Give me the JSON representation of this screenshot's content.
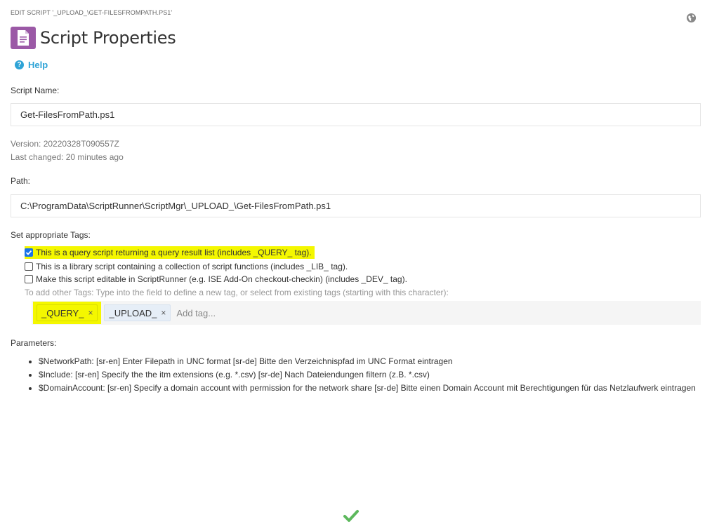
{
  "header": {
    "breadcrumb": "EDIT SCRIPT '_UPLOAD_\\GET-FILESFROMPATH.PS1'",
    "title": "Script Properties",
    "help_label": "Help",
    "help_glyph": "?"
  },
  "script_name": {
    "label": "Script Name:",
    "value": "Get-FilesFromPath.ps1"
  },
  "meta": {
    "version": "Version: 20220328T090557Z",
    "last_changed": "Last changed: 20 minutes ago"
  },
  "path": {
    "label": "Path:",
    "value": "C:\\ProgramData\\ScriptRunner\\ScriptMgr\\_UPLOAD_\\Get-FilesFromPath.ps1"
  },
  "tags": {
    "label": "Set appropriate Tags:",
    "options": [
      {
        "label": "This is a query script returning a query result list (includes _QUERY_ tag).",
        "checked": true
      },
      {
        "label": "This is a library script containing a collection of script functions (includes _LIB_ tag).",
        "checked": false
      },
      {
        "label": "Make this script editable in ScriptRunner (e.g. ISE Add-On checkout-checkin) (includes _DEV_ tag).",
        "checked": false
      }
    ],
    "hint": "To add other Tags: Type into the field to define a new tag, or select from existing tags (starting with this character):",
    "items": [
      {
        "label": "_QUERY_",
        "remove": "×"
      },
      {
        "label": "_UPLOAD_",
        "remove": "×"
      }
    ],
    "input_placeholder": "Add tag..."
  },
  "parameters": {
    "label": "Parameters:",
    "items": [
      "$NetworkPath: [sr-en] Enter Filepath in UNC format [sr-de] Bitte den Verzeichnispfad im UNC Format eintragen",
      "$Include: [sr-en] Specify the the itm extensions (e.g. *.csv) [sr-de] Nach Dateiendungen filtern (z.B. *.csv)",
      "$DomainAccount: [sr-en] Specify a domain account with permission for the network share [sr-de] Bitte einen Domain Account mit Berechtigungen für das Netzlaufwerk eintragen"
    ]
  },
  "colors": {
    "accent": "#2ea3d6",
    "highlight": "#f4f700",
    "doc_icon": "#9b59a6",
    "confirm": "#5cb85c"
  },
  "icons": {
    "globe": "globe-icon",
    "doc": "document-icon",
    "help": "help-circle-icon",
    "confirm": "checkmark-icon"
  }
}
